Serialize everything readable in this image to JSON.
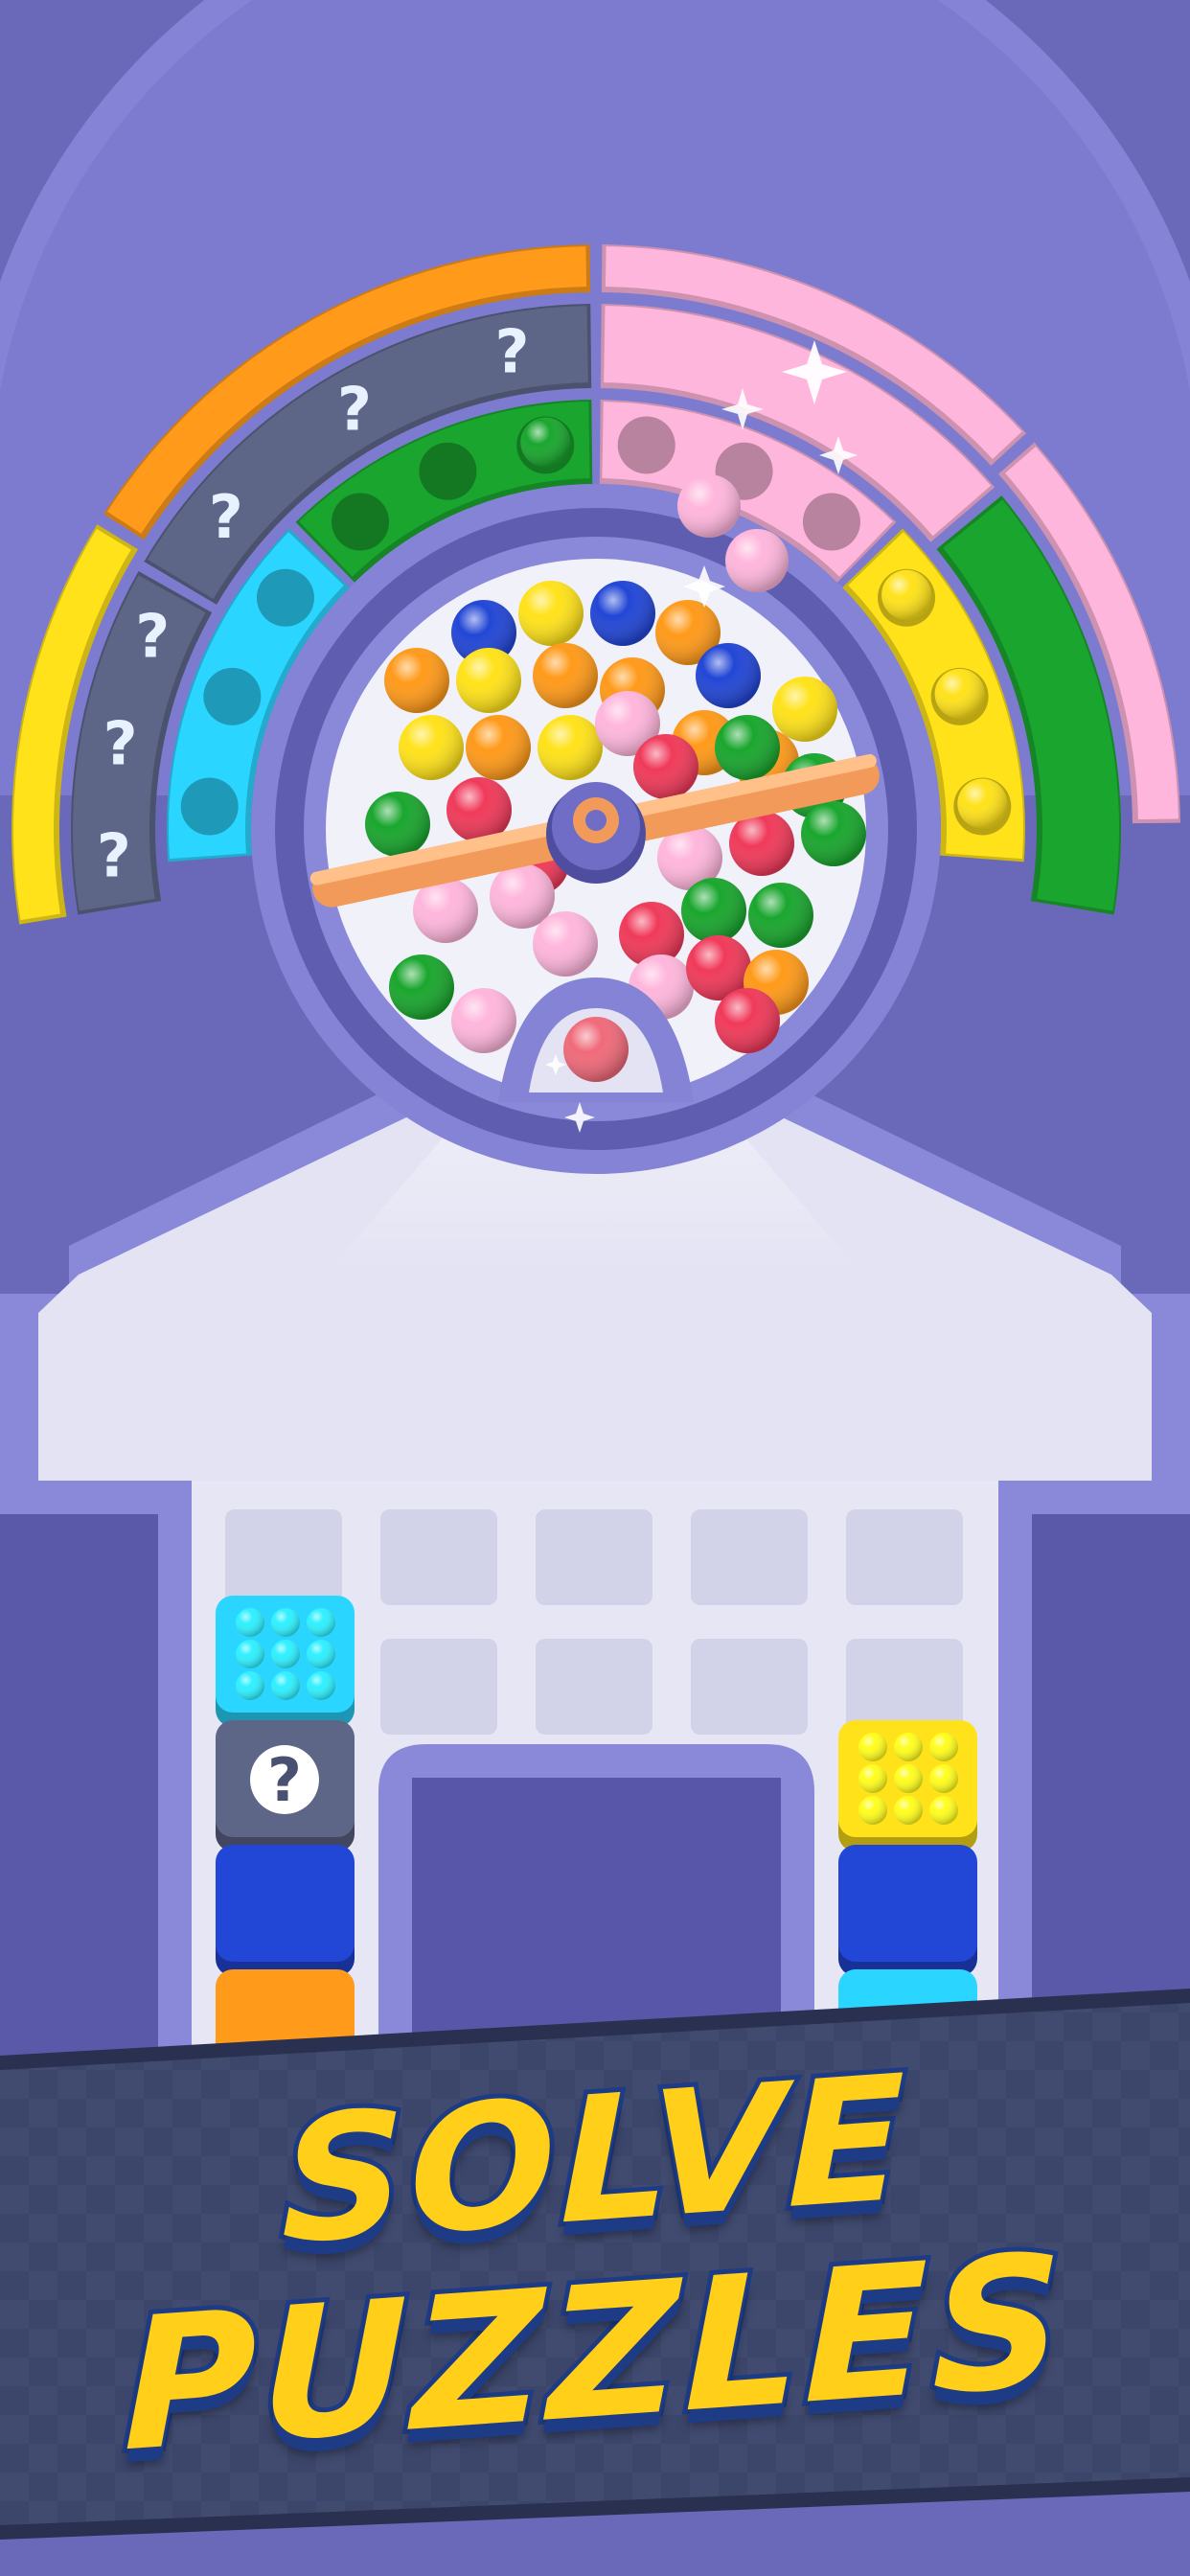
{
  "banner": {
    "line1": "SOLVE",
    "line2": "PUZZLES"
  },
  "colors": {
    "background": "#6a68b8",
    "tray": "#8a88d8",
    "tray_inner": "#e6e6f5",
    "orange": "#ff9a1a",
    "pink": "#ffb6dc",
    "green": "#1aa62e",
    "yellow": "#ffe21a",
    "cyan": "#2ad6ff",
    "blue": "#2246d6",
    "red": "#f03a5a",
    "mystery": "#5e6688",
    "banner_band": "#3c466a",
    "banner_text": "#ffcf1a"
  },
  "ring_segments": [
    {
      "color": "orange",
      "slots": 0,
      "mystery": false
    },
    {
      "color": "mystery",
      "slots": 0,
      "mystery": true
    },
    {
      "color": "green",
      "slots": 3,
      "mystery": false
    },
    {
      "color": "pink",
      "slots": 0,
      "mystery": false
    },
    {
      "color": "pink",
      "slots": 0,
      "mystery": false
    },
    {
      "color": "pink",
      "slots": 3,
      "mystery": false
    },
    {
      "color": "yellow",
      "slots": 0,
      "mystery": false
    },
    {
      "color": "mystery",
      "slots": 0,
      "mystery": true
    },
    {
      "color": "cyan",
      "slots": 3,
      "mystery": false
    },
    {
      "color": "pink",
      "slots": 0,
      "mystery": false
    },
    {
      "color": "green",
      "slots": 0,
      "mystery": false
    },
    {
      "color": "yellow",
      "slots": 3,
      "mystery": false
    }
  ],
  "drum_balls": [
    "blue",
    "yellow",
    "blue",
    "orange",
    "orange",
    "yellow",
    "orange",
    "orange",
    "blue",
    "yellow",
    "yellow",
    "yellow",
    "orange",
    "yellow",
    "pink",
    "orange",
    "orange",
    "orange",
    "yellow",
    "green",
    "red",
    "red",
    "red",
    "green",
    "green",
    "pink",
    "pink",
    "pink",
    "pink",
    "red",
    "green",
    "green",
    "pink",
    "green",
    "pink",
    "pink",
    "red",
    "green",
    "green",
    "pink",
    "pink",
    "red",
    "orange",
    "red"
  ],
  "grid": {
    "rows": 2,
    "cols": 5
  },
  "stacks": [
    {
      "column": "left",
      "blocks": [
        "cyan",
        "mystery",
        "blue",
        "orange"
      ]
    },
    {
      "column": "right",
      "blocks": [
        "yellow",
        "blue",
        "cyan"
      ]
    }
  ],
  "mystery_mark": "?"
}
